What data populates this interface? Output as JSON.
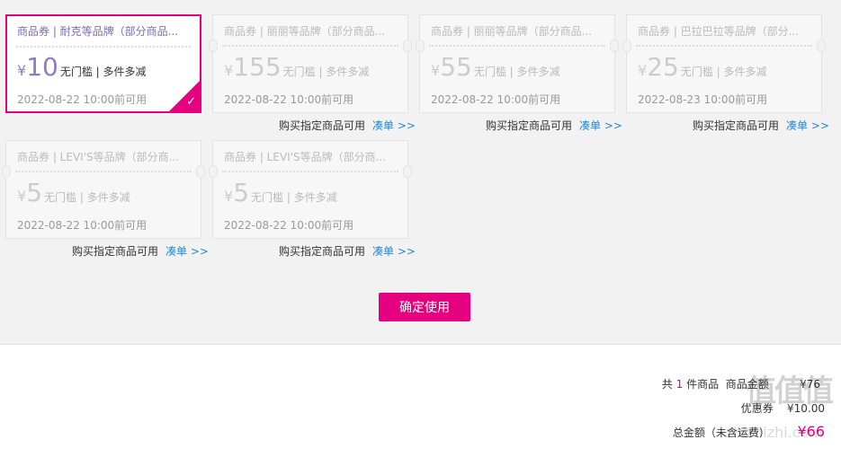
{
  "coupons": [
    {
      "title": "商品券 | 耐克等品牌（部分商品...",
      "yen": "¥",
      "value": "10",
      "condition": "无门槛 | 多件多减",
      "date": "2022-08-22 10:00前可用"
    },
    {
      "title": "商品券 | 丽丽等品牌（部分商品...",
      "yen": "¥",
      "value": "155",
      "condition": "无门槛 | 多件多减",
      "date": "2022-08-22 10:00前可用"
    },
    {
      "title": "商品券 | 丽丽等品牌（部分商品...",
      "yen": "¥",
      "value": "55",
      "condition": "无门槛 | 多件多减",
      "date": "2022-08-22 10:00前可用"
    },
    {
      "title": "商品券 | 巴拉巴拉等品牌（部分...",
      "yen": "¥",
      "value": "25",
      "condition": "无门槛 | 多件多减",
      "date": "2022-08-23 10:00前可用"
    },
    {
      "title": "商品券 | LEVI'S等品牌（部分商...",
      "yen": "¥",
      "value": "5",
      "condition": "无门槛 | 多件多减",
      "date": "2022-08-22 10:00前可用"
    },
    {
      "title": "商品券 | LEVI'S等品牌（部分商...",
      "yen": "¥",
      "value": "5",
      "condition": "无门槛 | 多件多减",
      "date": "2022-08-22 10:00前可用"
    }
  ],
  "coupon_footer": {
    "note": "购买指定商品可用",
    "link": "凑单 >>"
  },
  "confirm_button": "确定使用",
  "summary": {
    "count_prefix": "共",
    "count": "1",
    "count_suffix": "件商品",
    "amount_label": "商品金额",
    "amount_value": "¥76",
    "discount_label": "优惠券",
    "discount_value": "¥10.00",
    "total_label": "总金额（未含运费）",
    "total_value": "¥66"
  },
  "watermark": {
    "logo": "值值值",
    "site": "zhizhizhi.com"
  },
  "colors": {
    "accent": "#e4007f",
    "link": "#1f89d6",
    "coupon_text": "#8f7dc0"
  }
}
